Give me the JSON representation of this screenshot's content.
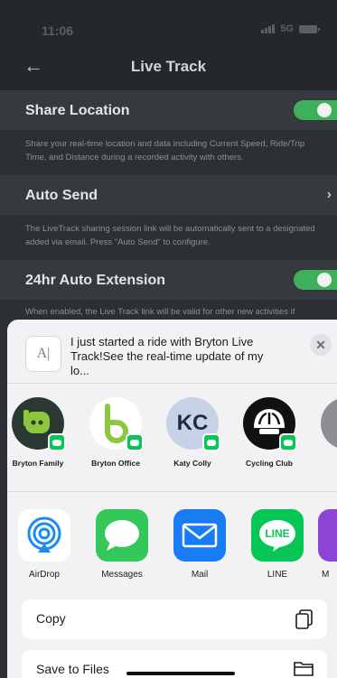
{
  "status_bar": {
    "time": "11:06",
    "network": "5G"
  },
  "nav": {
    "back_icon": "back-arrow-icon",
    "title": "Live Track"
  },
  "settings": [
    {
      "label": "Share Location",
      "control": "toggle",
      "on": true,
      "description": "Share your real-time location and data including Current Speed, Ride/Trip Time, and Distance during a recorded activity with others."
    },
    {
      "label": "Auto Send",
      "control": "chevron",
      "description": "The LiveTrack sharing session link will be automatically sent to a designated added via email. Press \"Auto Send\" to configure."
    },
    {
      "label": "24hr Auto Extension",
      "control": "toggle",
      "on": true,
      "description": "When enabled, the Live Track link will be valid for other new activities if"
    }
  ],
  "share_sheet": {
    "preview_glyph": "A|",
    "preview_text": "I just started a ride with Bryton Live Track!See the real-time update of my lo...",
    "contacts": [
      {
        "name": "Bryton Family",
        "badge": "LINE"
      },
      {
        "name": "Bryton Office",
        "badge": "LINE"
      },
      {
        "name": "Katy Colly",
        "initials": "KC",
        "badge": "LINE"
      },
      {
        "name": "Cycling Club",
        "badge": "LINE"
      }
    ],
    "apps": [
      {
        "name": "AirDrop",
        "icon": "airdrop-icon"
      },
      {
        "name": "Messages",
        "icon": "messages-icon"
      },
      {
        "name": "Mail",
        "icon": "mail-icon"
      },
      {
        "name": "LINE",
        "icon": "line-icon",
        "label": "LINE"
      },
      {
        "name": "M",
        "icon": "more-app-icon"
      }
    ],
    "actions": [
      {
        "label": "Copy",
        "icon": "copy-icon"
      },
      {
        "label": "Save to Files",
        "icon": "folder-icon"
      }
    ]
  },
  "colors": {
    "toggle_on": "#3fb05a",
    "line_green": "#06c755",
    "bryton_green": "#8dc63f",
    "messages_green": "#34c759",
    "mail_blue": "#1a7cf5",
    "airdrop_blue": "#1a8cf0"
  }
}
